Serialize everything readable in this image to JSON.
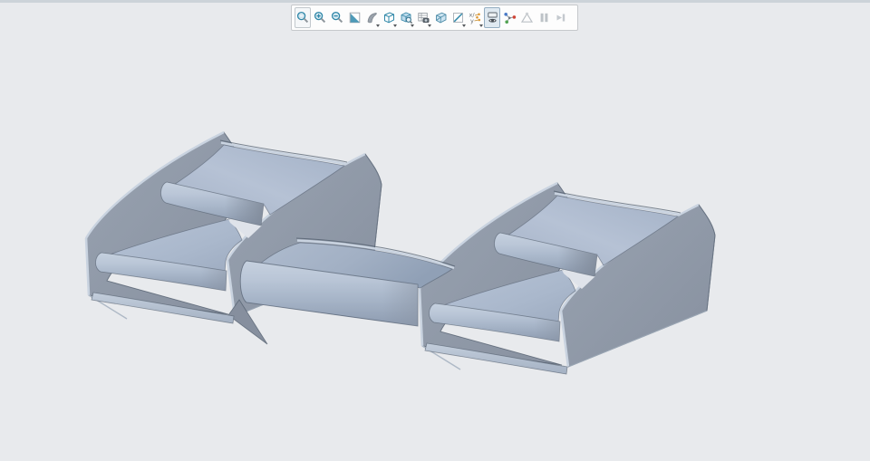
{
  "app": {
    "kind": "cad-3d-viewport",
    "visible_text": [],
    "colors": {
      "background": "#e8eaed",
      "top_strip": "#ccd3d9",
      "toolbar_bg": "#fdfdfd",
      "toolbar_border": "#c6c9cc",
      "accent_teal": "#2f87a8",
      "pressed_bg": "#dfe9f1",
      "pressed_border": "#93adc1",
      "model_face_dark": "#8d96a4",
      "model_face_light": "#b6c2d5",
      "model_edge_highlight": "#c9d3e0",
      "model_outline": "#5c6878"
    }
  },
  "toolbar": {
    "items": [
      {
        "name": "refit",
        "state": "hover",
        "dropdown": false
      },
      {
        "name": "zoom-in",
        "state": "normal",
        "dropdown": false
      },
      {
        "name": "zoom-out",
        "state": "normal",
        "dropdown": false
      },
      {
        "name": "repaint",
        "state": "normal",
        "dropdown": false
      },
      {
        "name": "shading-style",
        "state": "normal",
        "dropdown": true
      },
      {
        "name": "display-style",
        "state": "normal",
        "dropdown": true
      },
      {
        "name": "saved-views",
        "state": "normal",
        "dropdown": true
      },
      {
        "name": "view-manager",
        "state": "normal",
        "dropdown": true
      },
      {
        "name": "perspective",
        "state": "normal",
        "dropdown": false
      },
      {
        "name": "datum-display",
        "state": "normal",
        "dropdown": true
      },
      {
        "name": "annotation-display",
        "state": "normal",
        "dropdown": true
      },
      {
        "name": "graphics-display",
        "state": "pressed",
        "dropdown": false
      },
      {
        "name": "spin-center",
        "state": "normal",
        "dropdown": false
      },
      {
        "name": "geometry-check",
        "state": "disabled",
        "dropdown": false
      },
      {
        "name": "pause",
        "state": "disabled",
        "dropdown": false
      },
      {
        "name": "resume",
        "state": "disabled",
        "dropdown": false
      }
    ]
  },
  "viewport": {
    "model": "wing-assembly",
    "parts": [
      "left-endplate",
      "left-upper-flap",
      "left-lower-flap",
      "left-support-plate",
      "center-main-plane",
      "right-support-plate",
      "right-upper-flap",
      "right-lower-flap",
      "right-endplate"
    ]
  }
}
